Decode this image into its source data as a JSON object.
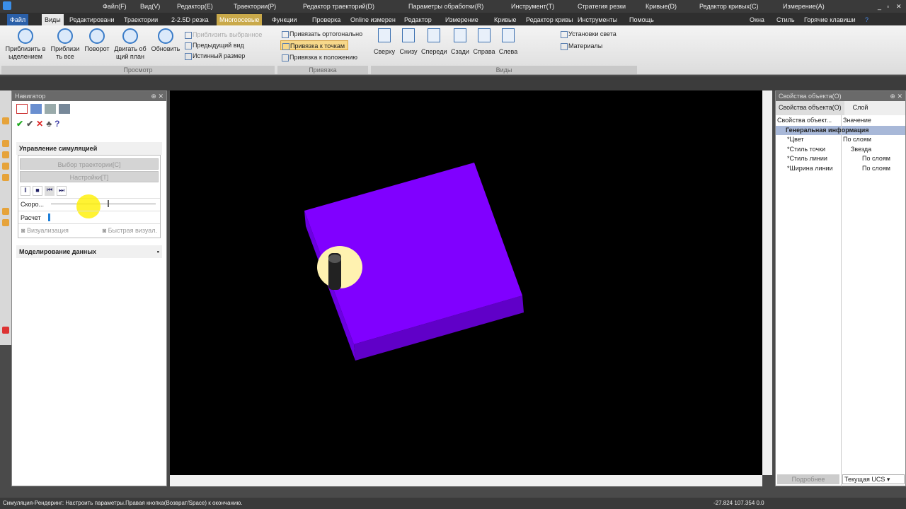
{
  "titlebar": {
    "menus": [
      "Файл(F)",
      "Вид(V)",
      "Редактор(E)",
      "Траектории(P)",
      "Редактор траекторий(D)",
      "Параметры обработки(R)",
      "Инструмент(T)",
      "Стратегия резки",
      "Кривые(D)",
      "Редактор кривых(C)",
      "Измерение(A)"
    ]
  },
  "tabs": [
    "Файл",
    "Виды",
    "Редактировани",
    "Траектории",
    "2-2.5D резка",
    "Многоосевые",
    "Функции",
    "Проверка",
    "Online измерен",
    "Редактор",
    "Измерение",
    "Кривые",
    "Редактор кривы",
    "Инструменты",
    "Помощь"
  ],
  "tab_right": {
    "windows": "Окна",
    "style": "Стиль",
    "hotkeys": "Горячие клавиши"
  },
  "ribbon": {
    "view_group": {
      "label": "Просмотр",
      "buttons": [
        "Приблизить в ыделением",
        "Приблизи ть все",
        "Поворот",
        "Двигать об щий план",
        "Обновить"
      ],
      "small": [
        "Приблизить выбранное",
        "Предыдущий вид",
        "Истинный размер"
      ]
    },
    "snap_group": {
      "label": "Привязка",
      "items": [
        "Привязать ортогонально",
        "Привязка к точкам",
        "Привязка к положению"
      ]
    },
    "views_group": {
      "label": "Виды",
      "views": [
        "Сверху",
        "Снизу",
        "Спереди",
        "Сзади",
        "Справа",
        "Слева"
      ],
      "extra": [
        "Установки света",
        "Материалы"
      ]
    }
  },
  "navigator": {
    "title": "Навигатор",
    "section": "Управление симуляцией",
    "select_path": "Выбор траектории[C]",
    "settings": "Настройки[T]",
    "speed_label": "Скоро...",
    "speed_value": 0.55,
    "calc_label": "Расчет",
    "calc_progress": 0.01,
    "visualization": "Визуализация",
    "fast_vis": "Быстрая визуал.",
    "data_modeling": "Моделирование данных"
  },
  "properties": {
    "title": "Свойства объекта(O)",
    "tabs": [
      "Свойства объекта(O)",
      "Слой"
    ],
    "col1": "Свойства объект...",
    "col2": "Значение",
    "group": "Генеральная информация",
    "rows": [
      {
        "k": "*Цвет",
        "v": "По слоям"
      },
      {
        "k": "*Стиль точки",
        "v": "Звезда"
      },
      {
        "k": "*Стиль линии",
        "v": "По слоям"
      },
      {
        "k": "*Ширина линии",
        "v": "По слоям"
      }
    ],
    "more": "Подробнее",
    "ucs": "Текущая UCS"
  },
  "status": {
    "message": "Симуляция-Рендеринг: Настроить параметры.Правая кнопка(Возврат/Space) к окончанию.",
    "coords": "-27.824 107.354 0.0"
  },
  "colors": {
    "part": "#8000ff",
    "part_side": "#6200d0",
    "accent": "#f7d88a"
  }
}
